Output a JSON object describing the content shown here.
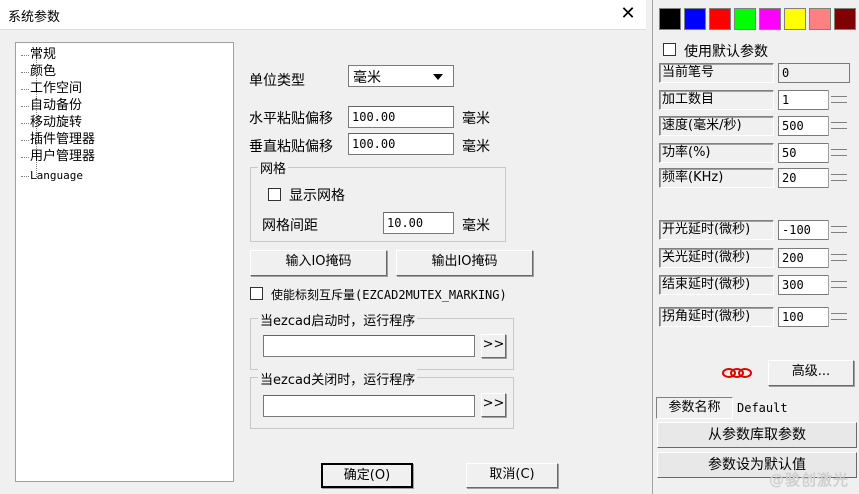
{
  "dialog": {
    "title": "系统参数",
    "close_label": "╳",
    "tree": [
      "常规",
      "颜色",
      "工作空间",
      "自动备份",
      "移动旋转",
      "插件管理器",
      "用户管理器",
      "Language"
    ],
    "unit_type_label": "单位类型",
    "unit_type_value": "毫米",
    "h_offset_label": "水平粘贴偏移",
    "h_offset_value": "100.00",
    "v_offset_label": "垂直粘贴偏移",
    "v_offset_value": "100.00",
    "unit_mm": "毫米",
    "grid_group": "网格",
    "show_grid_label": "显示网格",
    "grid_spacing_label": "网格间距",
    "grid_spacing_value": "10.00",
    "input_io_button": "输入IO掩码",
    "output_io_button": "输出IO掩码",
    "mutex_label": "使能标刻互斥量(EZCAD2MUTEX_MARKING)",
    "startup_group": "当ezcad启动时，运行程序",
    "shutdown_group": "当ezcad关闭时，运行程序",
    "browse_label": ">>",
    "ok_button": "确定(O)",
    "cancel_button": "取消(C)"
  },
  "panel": {
    "colors": [
      "#000000",
      "#0000ff",
      "#ff0000",
      "#00ff00",
      "#ff00ff",
      "#ffff00",
      "#ff8080",
      "#800000"
    ],
    "use_default_label": "使用默认参数",
    "params": [
      {
        "label": "当前笔号",
        "value": "0",
        "readonly": true
      },
      {
        "label": "加工数目",
        "value": "1"
      },
      {
        "label": "速度(毫米/秒)",
        "value": "500"
      },
      {
        "label": "功率(%)",
        "value": "50"
      },
      {
        "label": "频率(KHz)",
        "value": "20"
      },
      {
        "label": "开光延时(微秒)",
        "value": "-100"
      },
      {
        "label": "关光延时(微秒)",
        "value": "200"
      },
      {
        "label": "结束延时(微秒)",
        "value": "300"
      },
      {
        "label": "拐角延时(微秒)",
        "value": "100"
      }
    ],
    "advanced_button": "高级...",
    "param_name_label": "参数名称",
    "param_name_value": "Default",
    "load_from_lib_button": "从参数库取参数",
    "set_default_button": "参数设为默认值",
    "watermark": "@骏创激光"
  }
}
